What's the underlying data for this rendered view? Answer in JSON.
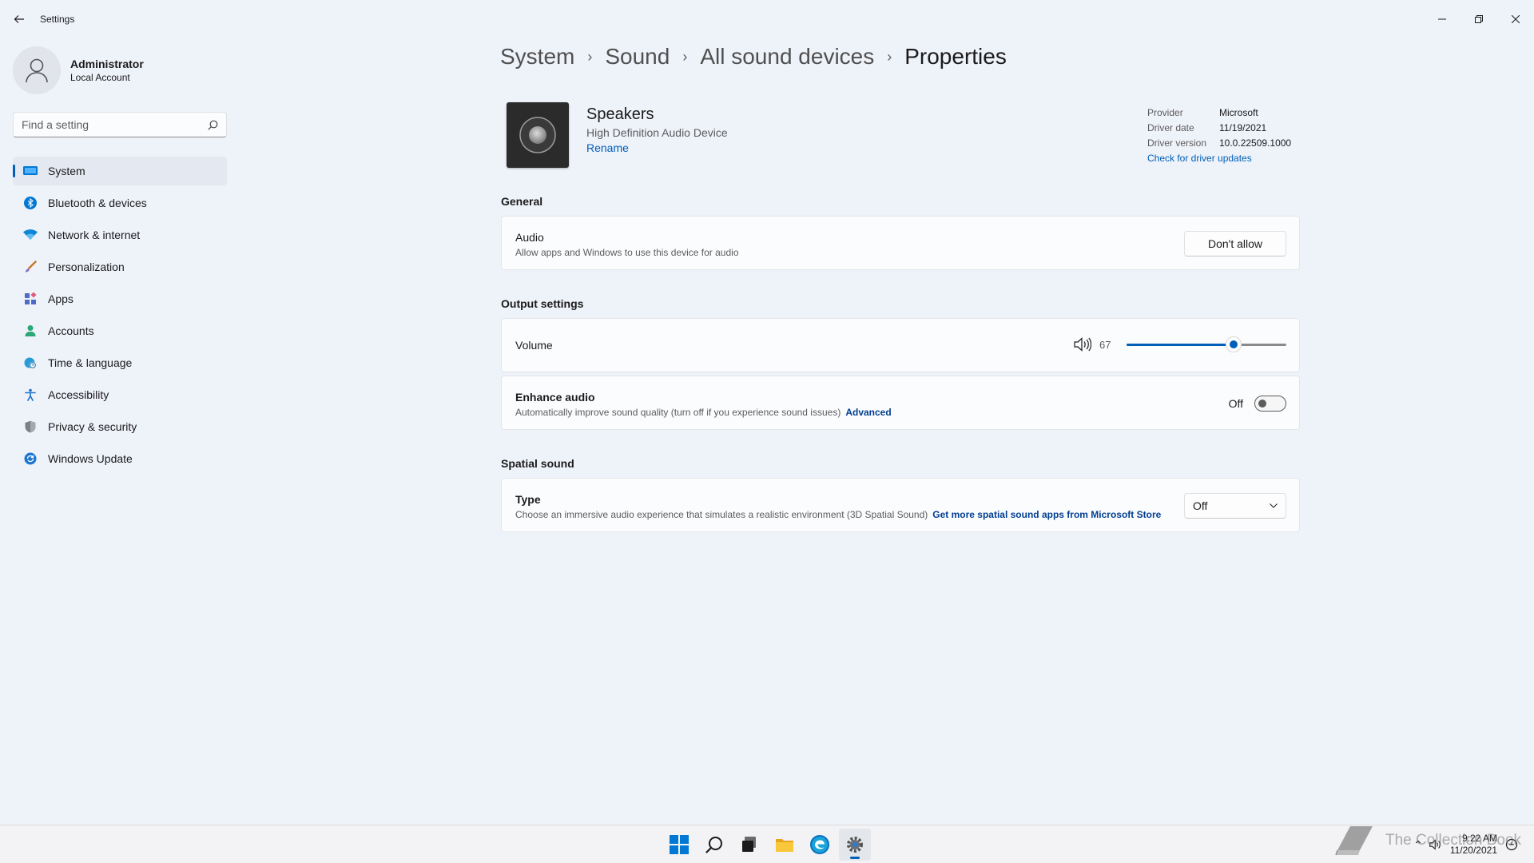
{
  "window": {
    "title": "Settings"
  },
  "user": {
    "name": "Administrator",
    "account_type": "Local Account"
  },
  "search": {
    "placeholder": "Find a setting"
  },
  "sidebar": {
    "items": [
      {
        "label": "System",
        "icon": "system-icon",
        "color": "#0078d4",
        "active": true
      },
      {
        "label": "Bluetooth & devices",
        "icon": "bluetooth-icon",
        "color": "#0078d4"
      },
      {
        "label": "Network & internet",
        "icon": "wifi-icon",
        "color": "#0078d4"
      },
      {
        "label": "Personalization",
        "icon": "brush-icon",
        "color": "#d77d26"
      },
      {
        "label": "Apps",
        "icon": "apps-icon",
        "color": "#5b6fbf"
      },
      {
        "label": "Accounts",
        "icon": "person-icon",
        "color": "#2aa876"
      },
      {
        "label": "Time & language",
        "icon": "globe-clock-icon",
        "color": "#2b9bd8"
      },
      {
        "label": "Accessibility",
        "icon": "accessibility-icon",
        "color": "#1a70c9"
      },
      {
        "label": "Privacy & security",
        "icon": "shield-icon",
        "color": "#6b6f78"
      },
      {
        "label": "Windows Update",
        "icon": "update-icon",
        "color": "#1d76d2"
      }
    ]
  },
  "breadcrumb": {
    "items": [
      "System",
      "Sound",
      "All sound devices"
    ],
    "current": "Properties"
  },
  "device": {
    "name": "Speakers",
    "description": "High Definition Audio Device",
    "rename_label": "Rename"
  },
  "driver": {
    "provider_label": "Provider",
    "provider": "Microsoft",
    "date_label": "Driver date",
    "date": "11/19/2021",
    "version_label": "Driver version",
    "version": "10.0.22509.1000",
    "update_link": "Check for driver updates"
  },
  "general": {
    "title": "General",
    "audio": {
      "title": "Audio",
      "description": "Allow apps and Windows to use this device for audio",
      "button": "Don't allow"
    }
  },
  "output": {
    "title": "Output settings",
    "volume": {
      "title": "Volume",
      "value": "67",
      "percent": 67
    },
    "enhance": {
      "title": "Enhance audio",
      "description": "Automatically improve sound quality (turn off if you experience sound issues)",
      "link": "Advanced",
      "state": "Off"
    }
  },
  "spatial": {
    "title": "Spatial sound",
    "type": {
      "title": "Type",
      "description": "Choose an immersive audio experience that simulates a realistic environment (3D Spatial Sound)",
      "link": "Get more spatial sound apps from Microsoft Store",
      "selected": "Off"
    }
  },
  "taskbar": {
    "time": "9:22 AM",
    "date": "11/20/2021"
  },
  "watermark": {
    "text": "The Collection Book"
  },
  "colors": {
    "accent": "#005fb8",
    "background": "#eef2f9",
    "card": "#fbfcfd"
  }
}
